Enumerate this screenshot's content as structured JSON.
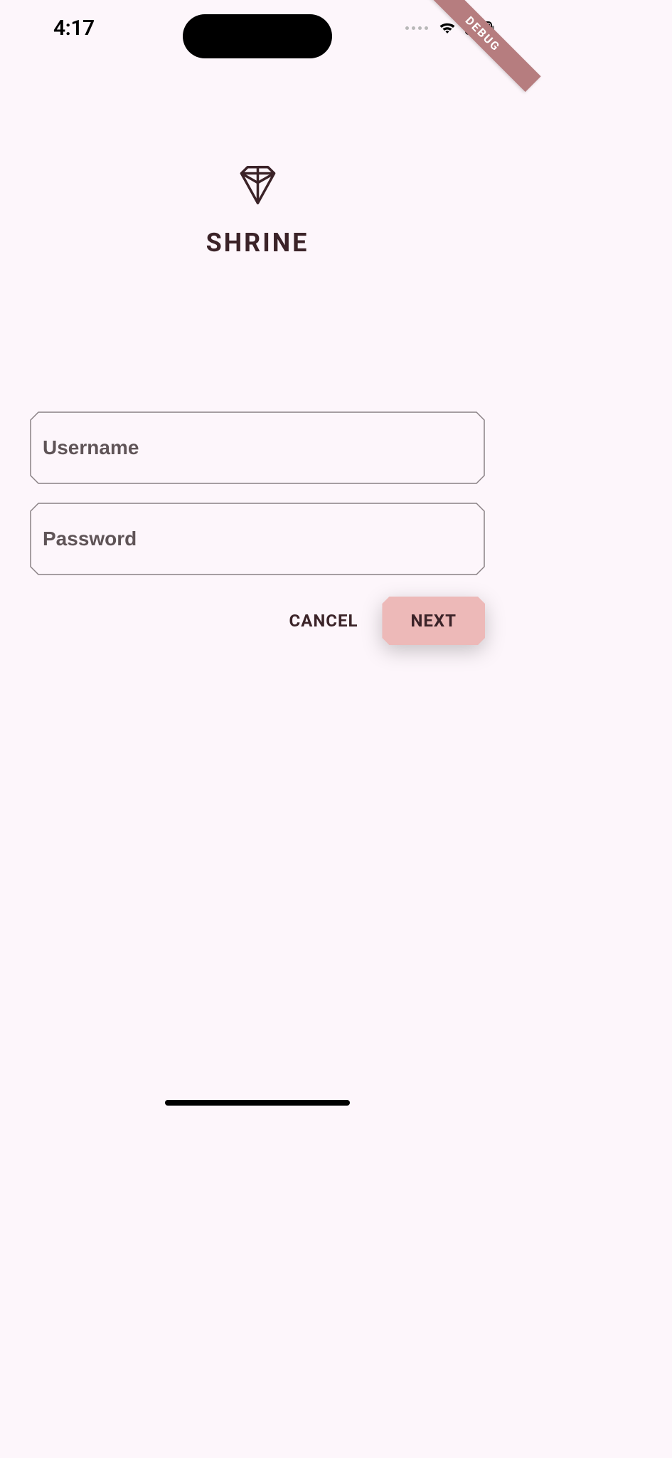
{
  "status": {
    "time": "4:17"
  },
  "debug_banner": "DEBUG",
  "app": {
    "title": "SHRINE"
  },
  "form": {
    "username_placeholder": "Username",
    "username_value": "",
    "password_placeholder": "Password",
    "password_value": ""
  },
  "buttons": {
    "cancel": "CANCEL",
    "next": "NEXT"
  },
  "colors": {
    "background": "#fdf6fb",
    "text_primary": "#3b2328",
    "accent": "#edb9b8",
    "debug": "#b67d7f"
  }
}
